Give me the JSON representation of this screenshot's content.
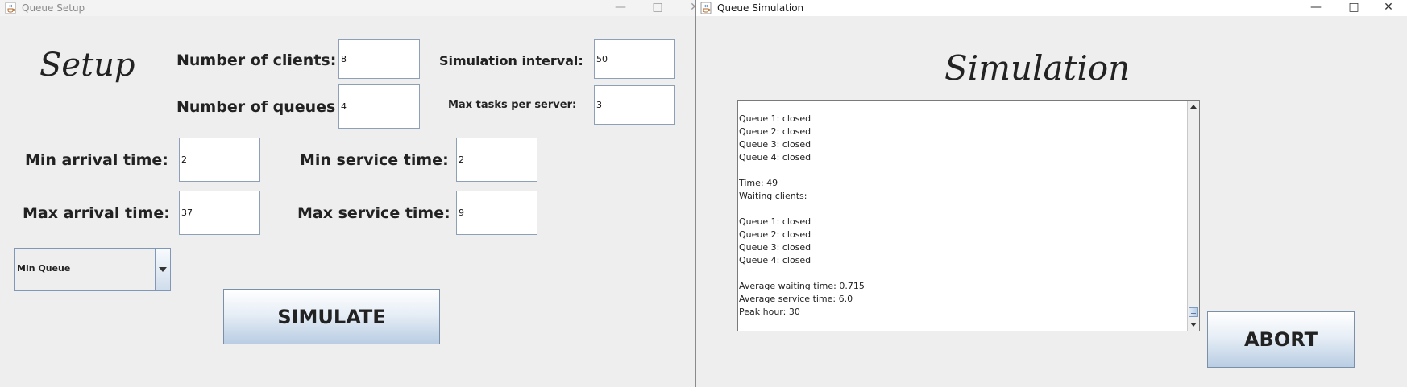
{
  "setup_window": {
    "title": "Queue Setup",
    "heading": "Setup",
    "controls": {
      "minimize": "—",
      "maximize": "□",
      "close": "✕"
    },
    "labels": {
      "num_clients": "Number of clients:",
      "num_queues": "Number of queues",
      "sim_interval": "Simulation interval:",
      "max_tasks": "Max tasks per server:",
      "min_arrival": "Min arrival time:",
      "max_arrival": "Max arrival time:",
      "min_service": "Min service time:",
      "max_service": "Max service time:"
    },
    "values": {
      "num_clients": "8",
      "num_queues": "4",
      "sim_interval": "50",
      "max_tasks": "3",
      "min_arrival": "2",
      "max_arrival": "37",
      "min_service": "2",
      "max_service": "9"
    },
    "strategy_selected": "Min Queue",
    "simulate_button": "SIMULATE"
  },
  "simulation_window": {
    "title": "Queue Simulation",
    "heading": "Simulation",
    "controls": {
      "minimize": "—",
      "maximize": "□",
      "close": "✕"
    },
    "log": "Queue 1: closed\nQueue 2: closed\nQueue 3: closed\nQueue 4: closed\n\nTime: 49\nWaiting clients:\n\nQueue 1: closed\nQueue 2: closed\nQueue 3: closed\nQueue 4: closed\n\nAverage waiting time: 0.715\nAverage service time: 6.0\nPeak hour: 30",
    "abort_button": "ABORT"
  },
  "icons": {
    "app_icon": "java-coffee-cup-icon",
    "dropdown": "chevron-down-icon",
    "scroll_up": "arrow-up-icon",
    "scroll_down": "arrow-down-icon"
  },
  "colors": {
    "window_bg": "#eeeeee",
    "field_border": "#8e9fb8",
    "button_gradient_bottom": "#b9cde3",
    "text": "#222222"
  }
}
